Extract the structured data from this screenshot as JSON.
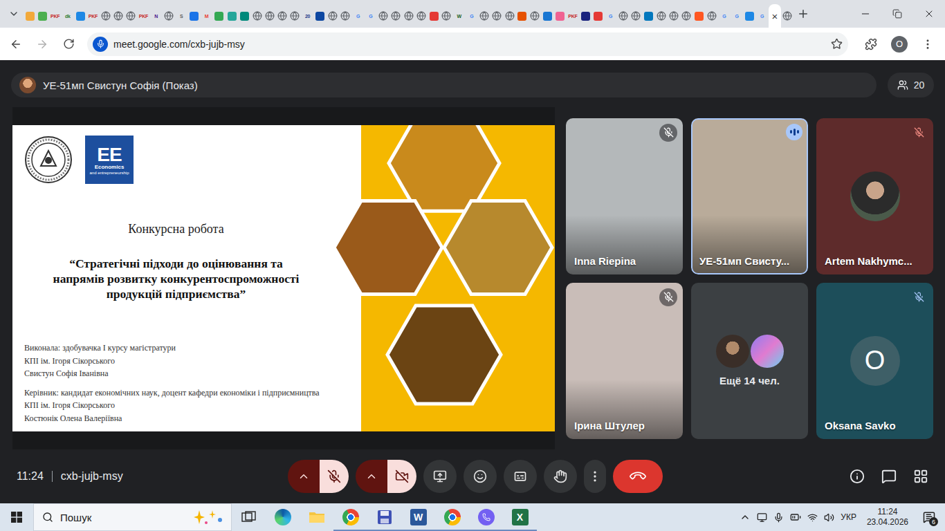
{
  "browser": {
    "tabs": [
      {
        "kind": "color",
        "color": "#f2a93b",
        "selected": false
      },
      {
        "kind": "color",
        "color": "#4caf50",
        "selected": false
      },
      {
        "kind": "letter",
        "text": "PKF",
        "color": "#c62828",
        "selected": false
      },
      {
        "kind": "letter",
        "text": "dk",
        "color": "#2e7d32",
        "selected": false
      },
      {
        "kind": "color",
        "color": "#1e88e5",
        "selected": false
      },
      {
        "kind": "letter",
        "text": "PKF",
        "color": "#c62828",
        "selected": false
      },
      {
        "kind": "globe",
        "selected": false
      },
      {
        "kind": "globe",
        "selected": false
      },
      {
        "kind": "globe",
        "selected": false
      },
      {
        "kind": "letter",
        "text": "PKF",
        "color": "#c62828",
        "selected": false
      },
      {
        "kind": "letter",
        "text": "N",
        "color": "#4a148c",
        "selected": false
      },
      {
        "kind": "globe",
        "selected": false
      },
      {
        "kind": "letter",
        "text": "S",
        "color": "#616161",
        "selected": false
      },
      {
        "kind": "color",
        "color": "#1a73e8",
        "selected": false
      },
      {
        "kind": "letter",
        "text": "M",
        "color": "#ea4335",
        "selected": false
      },
      {
        "kind": "color",
        "color": "#34a853",
        "selected": false
      },
      {
        "kind": "color",
        "color": "#26a69a",
        "selected": false
      },
      {
        "kind": "color",
        "color": "#00897b",
        "selected": false
      },
      {
        "kind": "globe",
        "selected": false
      },
      {
        "kind": "globe",
        "selected": false
      },
      {
        "kind": "globe",
        "selected": false
      },
      {
        "kind": "globe",
        "selected": false
      },
      {
        "kind": "letter",
        "text": "20",
        "color": "#1e3a8a",
        "selected": false
      },
      {
        "kind": "color",
        "color": "#0d47a1",
        "selected": false
      },
      {
        "kind": "globe",
        "selected": false
      },
      {
        "kind": "globe",
        "selected": false
      },
      {
        "kind": "letter",
        "text": "G",
        "color": "#4285f4",
        "selected": false
      },
      {
        "kind": "letter",
        "text": "G",
        "color": "#4285f4",
        "selected": false
      },
      {
        "kind": "globe",
        "selected": false
      },
      {
        "kind": "globe",
        "selected": false
      },
      {
        "kind": "globe",
        "selected": false
      },
      {
        "kind": "globe",
        "selected": false
      },
      {
        "kind": "color",
        "color": "#e53935",
        "selected": false
      },
      {
        "kind": "globe",
        "selected": false
      },
      {
        "kind": "letter",
        "text": "W",
        "color": "#1b5e20",
        "selected": false
      },
      {
        "kind": "letter",
        "text": "G",
        "color": "#4285f4",
        "selected": false
      },
      {
        "kind": "globe",
        "selected": false
      },
      {
        "kind": "globe",
        "selected": false
      },
      {
        "kind": "globe",
        "selected": false
      },
      {
        "kind": "color",
        "color": "#e65100",
        "selected": false
      },
      {
        "kind": "globe",
        "selected": false
      },
      {
        "kind": "color",
        "color": "#1976d2",
        "selected": false
      },
      {
        "kind": "color",
        "color": "#f06292",
        "selected": false
      },
      {
        "kind": "letter",
        "text": "PKF",
        "color": "#c62828",
        "selected": false
      },
      {
        "kind": "color",
        "color": "#1a237e",
        "selected": false
      },
      {
        "kind": "color",
        "color": "#e53935",
        "selected": false
      },
      {
        "kind": "letter",
        "text": "G",
        "color": "#4285f4",
        "selected": false
      },
      {
        "kind": "globe",
        "selected": false
      },
      {
        "kind": "globe",
        "selected": false
      },
      {
        "kind": "color",
        "color": "#0277bd",
        "selected": false
      },
      {
        "kind": "globe",
        "selected": false
      },
      {
        "kind": "globe",
        "selected": false
      },
      {
        "kind": "globe",
        "selected": false
      },
      {
        "kind": "color",
        "color": "#ff5722",
        "selected": false
      },
      {
        "kind": "globe",
        "selected": false
      },
      {
        "kind": "letter",
        "text": "G",
        "color": "#4285f4",
        "selected": false
      },
      {
        "kind": "letter",
        "text": "G",
        "color": "#4285f4",
        "selected": false
      },
      {
        "kind": "color",
        "color": "#1e88e5",
        "selected": false
      },
      {
        "kind": "letter",
        "text": "G",
        "color": "#4285f4",
        "selected": false
      },
      {
        "kind": "globe",
        "selected": true,
        "close": "×"
      },
      {
        "kind": "globe",
        "selected": false
      }
    ],
    "back_enabled": true,
    "forward_enabled": false,
    "url": "meet.google.com/cxb-jujb-msy",
    "profile": "O"
  },
  "meet": {
    "presenter": "УЕ-51мп Свистун Софія (Показ)",
    "participants": "20",
    "slide": {
      "logo_mark": "EE",
      "logo_title": "Economics",
      "logo_subtitle": "and entrepreneurship",
      "heading": "Конкурсна робота",
      "title_lines": [
        "“Стратегічні підходи до оцінювання та",
        "напрямів розвитку конкурентоспроможності",
        "продукцій підприємства”"
      ],
      "author_lines": [
        "Виконала: здобувачка I курсу магістратури",
        "КПІ ім. Ігоря Сікорського",
        "Свистун Софія Іванівна"
      ],
      "supervisor_lines": [
        "Керівник: кандидат економічних наук, доцент кафедри економіки і підприємництва",
        "КПІ ім. Ігоря Сікорського",
        "Костюнік Олена Валеріївна"
      ]
    },
    "tiles": [
      {
        "name": "Inna Riepina",
        "kind": "video",
        "muted": true,
        "speaking": false,
        "color": "#b4b8ba",
        "mic_color": "#ffffff"
      },
      {
        "name": "УЕ-51мп Свисту...",
        "kind": "video",
        "muted": false,
        "speaking": true,
        "color": "#b9ab9a",
        "mic_color": "#ffffff"
      },
      {
        "name": "Artem Nakhymc...",
        "kind": "photo",
        "muted": true,
        "speaking": false,
        "color": "#5e2b2b",
        "mic_color": "#f28b82"
      },
      {
        "name": "Ірина Штулер",
        "kind": "video",
        "muted": true,
        "speaking": false,
        "color": "#c9bdb8",
        "mic_color": "#ffffff"
      },
      {
        "name": "Ещё 14 чел.",
        "kind": "overflow",
        "muted": false,
        "speaking": false,
        "color": "#3c4043",
        "mic_color": "#ffffff"
      },
      {
        "name": "Oksana Savko",
        "kind": "letter",
        "letter": "O",
        "muted": true,
        "speaking": false,
        "color": "#1d4e5a",
        "mic_color": "#a8c7fa"
      }
    ],
    "time": "11:24",
    "code": "cxb-jujb-msy",
    "mic": {
      "on": false
    },
    "camera": {
      "on": false
    }
  },
  "taskbar": {
    "search": "Пошук",
    "apps": [
      {
        "kind": "taskview",
        "running": false
      },
      {
        "kind": "edge",
        "running": false
      },
      {
        "kind": "explorer",
        "running": false
      },
      {
        "kind": "chrome",
        "running": true
      },
      {
        "kind": "save",
        "running": true
      },
      {
        "kind": "word",
        "letter": "W",
        "running": true
      },
      {
        "kind": "chrome",
        "running": true
      },
      {
        "kind": "viber",
        "running": true
      },
      {
        "kind": "excel",
        "letter": "X",
        "running": true
      }
    ],
    "language": "УКР",
    "time": "11:24",
    "date": "23.04.2026",
    "notifications": "6"
  }
}
